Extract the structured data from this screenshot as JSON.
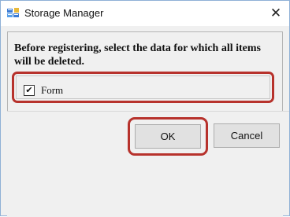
{
  "window": {
    "title": "Storage Manager",
    "close_glyph": "✕"
  },
  "panel": {
    "instruction": "Before registering, select the data for which all items will be deleted."
  },
  "options": [
    {
      "label": "Form",
      "checked": true,
      "check_glyph": "✔"
    }
  ],
  "buttons": {
    "ok_label": "OK",
    "cancel_label": "Cancel"
  },
  "colors": {
    "highlight": "#b7322c",
    "window_border": "#8fb0d6",
    "client_background": "#f0f0f0"
  },
  "icons": {
    "app": "storage-manager-icon",
    "close": "close-icon",
    "check": "checkmark-icon"
  }
}
